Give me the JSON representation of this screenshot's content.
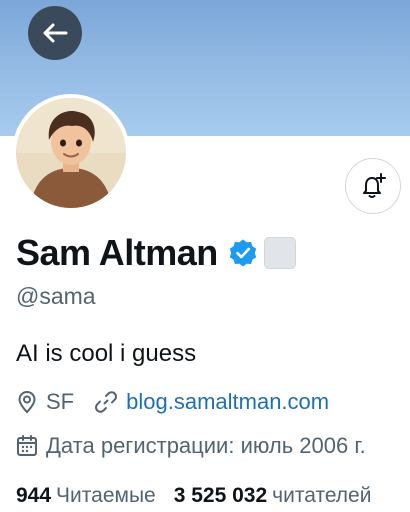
{
  "profile": {
    "display_name": "Sam Altman",
    "handle": "@sama",
    "bio": "AI is cool i guess",
    "location": "SF",
    "website": "blog.samaltman.com",
    "join_date": "Дата регистрации: июль 2006 г.",
    "following_count": "944",
    "following_label": "Читаемые",
    "followers_count": "3 525 032",
    "followers_label": "читателей"
  },
  "icons": {
    "back": "arrow-left-icon",
    "notify": "bell-plus-icon",
    "verified": "verified-badge-icon",
    "location": "location-pin-icon",
    "link": "link-icon",
    "calendar": "calendar-icon"
  },
  "colors": {
    "banner": "#8fb6e3",
    "verified": "#1d9bf0",
    "link": "#1d70b8",
    "secondary_text": "#536471"
  }
}
